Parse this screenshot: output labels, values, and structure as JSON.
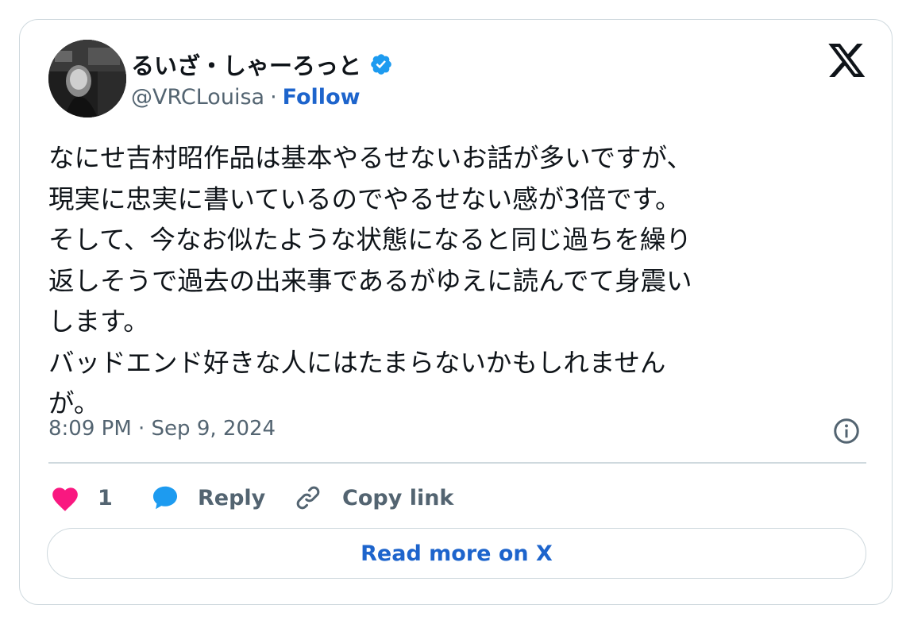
{
  "colors": {
    "text": "#0f1419",
    "secondary": "#536471",
    "link": "#1d64cc",
    "border": "#cfd9de",
    "heart": "#f91880",
    "reply_bubble": "#1d9bf0",
    "verified": "#1d9bf0"
  },
  "author": {
    "display_name": "るいざ・しゃーろっと",
    "handle": "@VRCLouisa",
    "separator": "·",
    "follow_label": "Follow",
    "verified": true,
    "avatar_icon": "profile-avatar"
  },
  "tweet": {
    "text": "なにせ吉村昭作品は基本やるせないお話が多いですが、\n現実に忠実に書いているのでやるせない感が3倍です。\nそして、今なお似たような状態になると同じ過ちを繰り\n返しそうで過去の出来事であるがゆえに読んでて身震い\nします。\nバッドエンド好きな人にはたまらないかもしれません\nが。",
    "timestamp": "8:09 PM · Sep 9, 2024"
  },
  "actions": {
    "like_count": "1",
    "reply_label": "Reply",
    "copy_link_label": "Copy link"
  },
  "read_more_label": "Read more on X",
  "icons": {
    "brand": "x-logo-icon",
    "info": "info-icon",
    "like": "heart-icon",
    "reply": "speech-bubble-icon",
    "copy": "link-icon",
    "verified": "verified-badge-icon"
  }
}
